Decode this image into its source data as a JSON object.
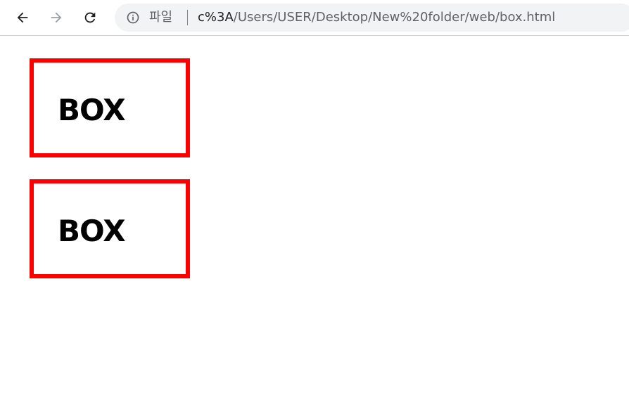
{
  "browser": {
    "scheme_label": "파일",
    "url_host": "c%3A",
    "url_path": "/Users/USER/Desktop/New%20folder/web/box.html",
    "icons": {
      "back": "back-arrow-icon",
      "forward": "forward-arrow-icon",
      "reload": "reload-icon",
      "info": "info-icon"
    }
  },
  "page": {
    "boxes": [
      {
        "label": "BOX"
      },
      {
        "label": "BOX"
      }
    ],
    "colors": {
      "box_border": "#ff0000",
      "text": "#000000",
      "background": "#ffffff"
    }
  }
}
